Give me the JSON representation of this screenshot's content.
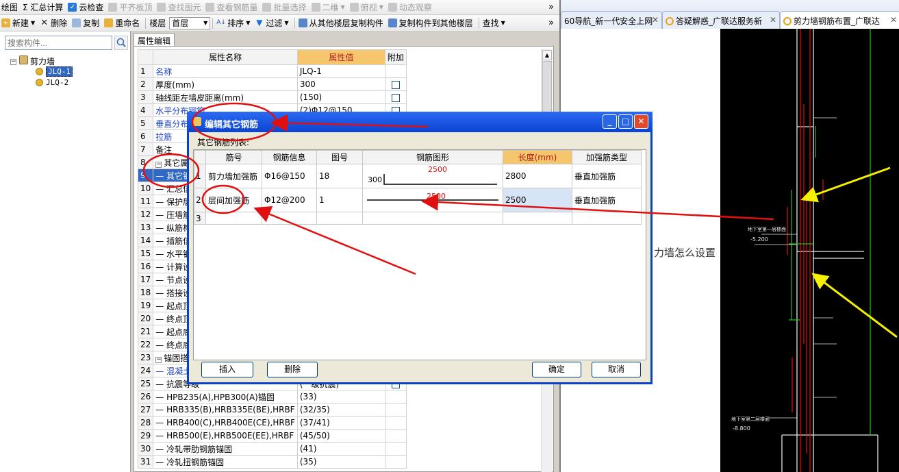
{
  "toolbar1": {
    "items": [
      {
        "label": "绘图",
        "disabled": false
      },
      {
        "label": "Σ 汇总计算",
        "disabled": false
      },
      {
        "label": "云检查",
        "disabled": false
      },
      {
        "label": "平齐板顶",
        "disabled": true
      },
      {
        "label": "查找图元",
        "disabled": true
      },
      {
        "label": "查看钢筋量",
        "disabled": true
      },
      {
        "label": "批量选择",
        "disabled": true
      },
      {
        "label": "二维",
        "disabled": true
      },
      {
        "label": "俯视",
        "disabled": true
      },
      {
        "label": "动态观察",
        "disabled": true
      }
    ],
    "more": "»"
  },
  "toolbar2": {
    "new_label": "新建",
    "delete_label": "删除",
    "copy_label": "复制",
    "rename_label": "重命名",
    "floor_label": "楼层",
    "floor_value": "首层",
    "sort_label": "排序",
    "filter_label": "过滤",
    "copy_from_floor_label": "从其他楼层复制构件",
    "copy_to_floor_label": "复制构件到其他楼层",
    "find_label": "查找",
    "more": "»"
  },
  "search": {
    "placeholder": "搜索构件..."
  },
  "tree": {
    "root": "剪力墙",
    "items": [
      "JLQ-1",
      "JLQ-2"
    ]
  },
  "prop": {
    "tab": "属性编辑",
    "headers": {
      "num": "",
      "name": "属性名称",
      "value": "属性值",
      "extra": "附加"
    },
    "rows": [
      {
        "n": "1",
        "name": "名称",
        "value": "JLQ-1",
        "blue": true,
        "chk": false
      },
      {
        "n": "2",
        "name": "厚度(mm)",
        "value": "300",
        "blue": false,
        "chk": true
      },
      {
        "n": "3",
        "name": "轴线距左墙皮距离(mm)",
        "value": "(150)",
        "blue": false,
        "chk": true
      },
      {
        "n": "4",
        "name": "水平分布钢筋",
        "value": "(2)Φ12@150",
        "blue": true,
        "chk": true
      },
      {
        "n": "5",
        "name": "垂直分布钢筋",
        "value": "",
        "blue": true,
        "chk": false
      },
      {
        "n": "6",
        "name": "拉筋",
        "value": "",
        "blue": true,
        "chk": false
      },
      {
        "n": "7",
        "name": "备注",
        "value": "",
        "blue": false,
        "chk": false
      },
      {
        "n": "8",
        "name": "其它属性",
        "value": "",
        "blue": false,
        "chk": false,
        "group": true
      },
      {
        "n": "9",
        "name": "— 其它钢筋",
        "value": "",
        "blue": false,
        "chk": false,
        "selected": true
      },
      {
        "n": "10",
        "name": "— 汇总信息",
        "value": "",
        "blue": false,
        "chk": false
      },
      {
        "n": "11",
        "name": "— 保护层厚度(mm)",
        "value": "",
        "blue": false,
        "chk": false
      },
      {
        "n": "12",
        "name": "— 压墙筋",
        "value": "",
        "blue": false,
        "chk": false
      },
      {
        "n": "13",
        "name": "— 纵筋构造",
        "value": "",
        "blue": false,
        "chk": false
      },
      {
        "n": "14",
        "name": "— 插筋信息",
        "value": "",
        "blue": false,
        "chk": false
      },
      {
        "n": "15",
        "name": "— 水平钢筋拐角增加搭接",
        "value": "",
        "blue": false,
        "chk": false
      },
      {
        "n": "16",
        "name": "— 计算设置",
        "value": "",
        "blue": false,
        "chk": false
      },
      {
        "n": "17",
        "name": "— 节点设置",
        "value": "",
        "blue": false,
        "chk": false
      },
      {
        "n": "18",
        "name": "— 搭接设置",
        "value": "",
        "blue": false,
        "chk": false
      },
      {
        "n": "19",
        "name": "— 起点顶标高(m)",
        "value": "",
        "blue": false,
        "chk": false
      },
      {
        "n": "20",
        "name": "— 终点顶标高(m)",
        "value": "",
        "blue": false,
        "chk": false
      },
      {
        "n": "21",
        "name": "— 起点底标高(m)",
        "value": "",
        "blue": false,
        "chk": false
      },
      {
        "n": "22",
        "name": "— 终点底标高(m)",
        "value": "",
        "blue": false,
        "chk": false
      },
      {
        "n": "23",
        "name": "锚固搭接",
        "value": "",
        "blue": false,
        "chk": false,
        "group": true
      },
      {
        "n": "24",
        "name": "— 混凝土强度等级",
        "value": "",
        "blue": true,
        "chk": false
      },
      {
        "n": "25",
        "name": "— 抗震等级",
        "value": "(一级抗震)",
        "blue": false,
        "chk": true
      },
      {
        "n": "26",
        "name": "— HPB235(A),HPB300(A)锚固",
        "value": "(33)",
        "blue": false,
        "chk": false
      },
      {
        "n": "27",
        "name": "— HRB335(B),HRB335E(BE),HRBF",
        "value": "(32/35)",
        "blue": false,
        "chk": false
      },
      {
        "n": "28",
        "name": "— HRB400(C),HRB400E(CE),HRBF",
        "value": "(37/41)",
        "blue": false,
        "chk": false
      },
      {
        "n": "29",
        "name": "— HRB500(E),HRB500E(EE),HRBF",
        "value": "(45/50)",
        "blue": false,
        "chk": false
      },
      {
        "n": "30",
        "name": "— 冷轧带肋钢筋锚固",
        "value": "(41)",
        "blue": false,
        "chk": false
      },
      {
        "n": "31",
        "name": "— 冷轧扭钢筋锚固",
        "value": "(35)",
        "blue": false,
        "chk": false
      }
    ]
  },
  "dialog": {
    "title": "编辑其它钢筋",
    "list_label": "其它钢筋列表:",
    "headers": [
      "",
      "筋号",
      "钢筋信息",
      "图号",
      "钢筋图形",
      "长度(mm)",
      "加强筋类型"
    ],
    "rows": [
      {
        "n": "1",
        "name": "剪力墙加强筋",
        "info": "Φ16@150",
        "fig": "18",
        "shape_left": "300",
        "shape_top": "2500",
        "length": "2800",
        "type": "垂直加强筋"
      },
      {
        "n": "2",
        "name": "层间加强筋",
        "info": "Φ12@200",
        "fig": "1",
        "shape_left": "",
        "shape_top": "2500",
        "length": "2500",
        "type": "垂直加强筋"
      },
      {
        "n": "3",
        "name": "",
        "info": "",
        "fig": "",
        "shape_left": "",
        "shape_top": "",
        "length": "",
        "type": ""
      }
    ],
    "buttons": {
      "insert": "插入",
      "delete": "删除",
      "ok": "确定",
      "cancel": "取消"
    }
  },
  "browser": {
    "tabs": [
      {
        "label": "60导航_新一代安全上网",
        "active": false
      },
      {
        "label": "答疑解惑_广联达服务新",
        "active": false
      },
      {
        "label": "剪力墙钢筋布置_广联达",
        "active": true
      }
    ],
    "page_text": "力墙怎么设置"
  },
  "cad": {
    "labels": [
      "地下室第一层楼面",
      "-5.200",
      "地下室第二层楼面",
      "-8.800"
    ]
  },
  "colors": {
    "selection": "#3168c6",
    "header_highlight": "#f5c66c",
    "annotation_red": "#e01010",
    "annotation_yellow": "#f4f000",
    "dialog_title": "#0a44d0"
  }
}
